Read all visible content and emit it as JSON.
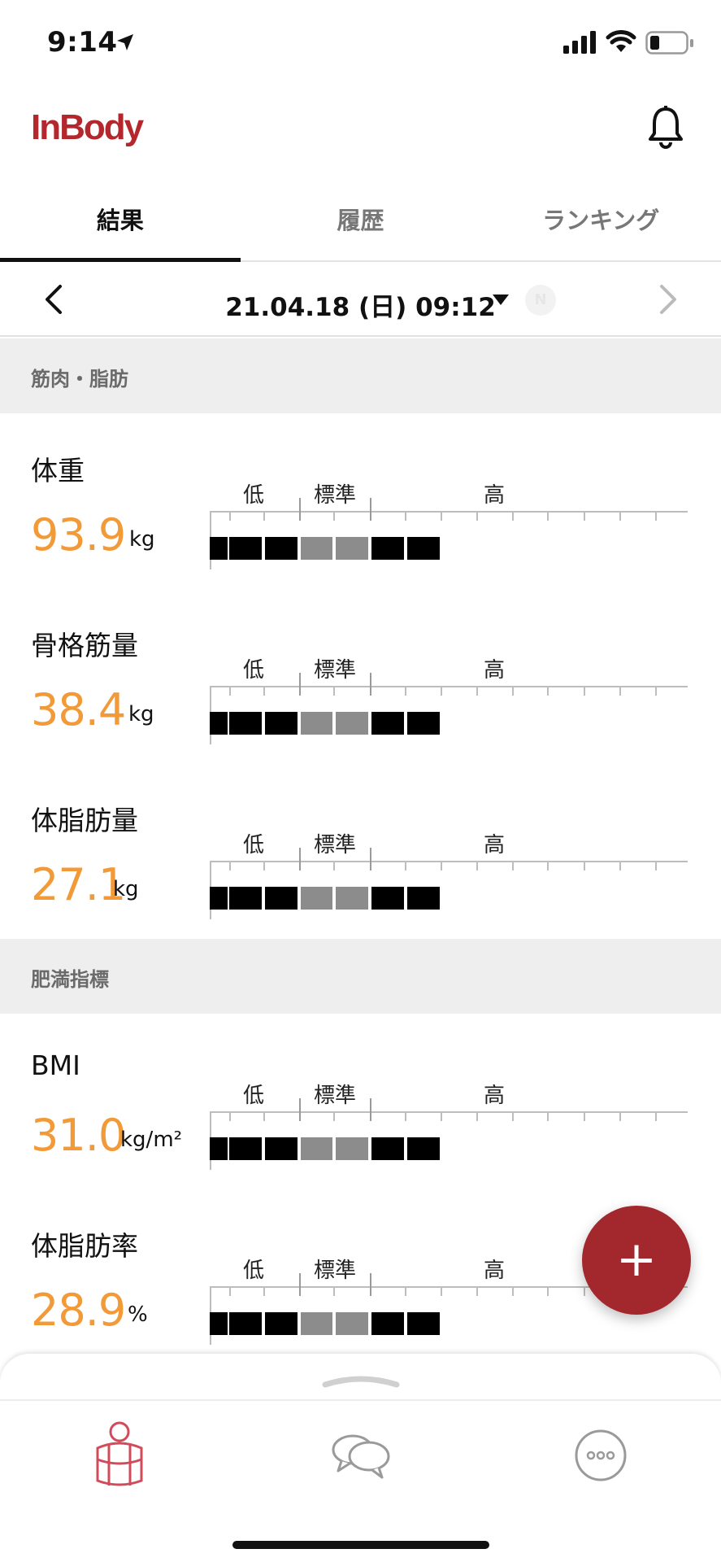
{
  "status": {
    "time": "9:14"
  },
  "header": {
    "logo": "InBody"
  },
  "tabs": [
    {
      "label": "結果",
      "active": true
    },
    {
      "label": "履歴",
      "active": false
    },
    {
      "label": "ランキング",
      "active": false
    }
  ],
  "date": {
    "text": "21.04.18 (日) 09:12",
    "badge": "N"
  },
  "sections": {
    "muscle_fat": "筋肉・脂肪",
    "obesity": "肥満指標"
  },
  "scale_labels": {
    "low": "低",
    "standard": "標準",
    "high": "高"
  },
  "metrics": [
    {
      "label": "体重",
      "value": "93.9",
      "unit": "kg",
      "level": 0.566
    },
    {
      "label": "骨格筋量",
      "value": "38.4",
      "unit": "kg",
      "level": 0.512
    },
    {
      "label": "体脂肪量",
      "value": "27.1",
      "unit": "kg",
      "level": 0.578
    },
    {
      "label": "BMI",
      "value": "31.0",
      "unit": "kg/m²",
      "level": 0.518
    },
    {
      "label": "体脂肪率",
      "value": "28.9",
      "unit": "%",
      "level": 0.57
    }
  ],
  "colors": {
    "accent": "#f29a38",
    "brand": "#b3272d",
    "fab": "#a3282e"
  },
  "icons": {
    "location": "location-arrow-icon",
    "bell": "bell-icon",
    "prev": "chevron-left-icon",
    "next": "chevron-right-icon",
    "fab": "plus-icon",
    "nav": [
      "body-icon",
      "chat-icon",
      "more-icon"
    ]
  }
}
